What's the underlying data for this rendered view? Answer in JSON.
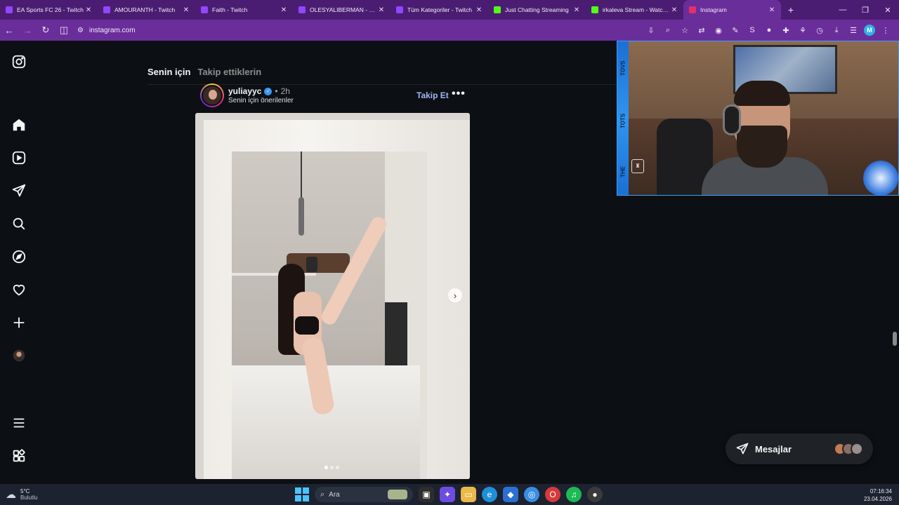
{
  "browser": {
    "tabs": [
      {
        "title": "EA Sports FC 26 - Twitch",
        "icon": "twitch-icon",
        "color": "#9146ff",
        "active": false
      },
      {
        "title": "AMOURANTH - Twitch",
        "icon": "twitch-icon",
        "color": "#9146ff",
        "active": false
      },
      {
        "title": "Faith - Twitch",
        "icon": "twitch-icon",
        "color": "#9146ff",
        "active": false
      },
      {
        "title": "OLESYALIBERMAN - Twitch",
        "icon": "twitch-icon",
        "color": "#9146ff",
        "active": false
      },
      {
        "title": "Tüm Kategoriler - Twitch",
        "icon": "twitch-icon",
        "color": "#9146ff",
        "active": false
      },
      {
        "title": "Just Chatting Streaming",
        "icon": "kick-icon",
        "color": "#53fc18",
        "active": false
      },
      {
        "title": "irkaleva Stream - Watch L",
        "icon": "kick-icon",
        "color": "#53fc18",
        "active": false
      },
      {
        "title": "Instagram",
        "icon": "instagram-icon",
        "color": "#e1306c",
        "active": true
      }
    ],
    "new_tab_symbol": "+",
    "window_controls": {
      "minimize": "—",
      "restore": "❐",
      "close": "✕"
    },
    "url": "instagram.com",
    "accent": "#4b1d72",
    "toolbar_accent": "#6a2e9b",
    "profile_letter": "M"
  },
  "instagram": {
    "sidebar_icons": [
      "instagram-logo-icon",
      "home-icon",
      "reels-icon",
      "messages-icon",
      "search-icon",
      "explore-icon",
      "heart-icon",
      "create-icon",
      "profile-icon",
      "menu-icon",
      "more-apps-icon"
    ],
    "feed_tabs": {
      "for_you": "Senin için",
      "following": "Takip ettiklerin"
    },
    "post": {
      "username": "yuliayyc",
      "verified": true,
      "separator": "•",
      "time": "2h",
      "subtitle": "Senin için önerilenler",
      "follow_label": "Takip Et",
      "more_label": "•••",
      "carousel_index": 1,
      "carousel_count": 3
    },
    "messages": {
      "label": "Mesajlar"
    }
  },
  "stream_overlay": {
    "side_text": [
      "THE",
      "TOTS",
      "TOVS"
    ]
  },
  "taskbar": {
    "weather_temp": "5°C",
    "weather_desc": "Bulutlu",
    "search_placeholder": "Ara",
    "time": "07:16:34",
    "date": "23.04.2026"
  }
}
